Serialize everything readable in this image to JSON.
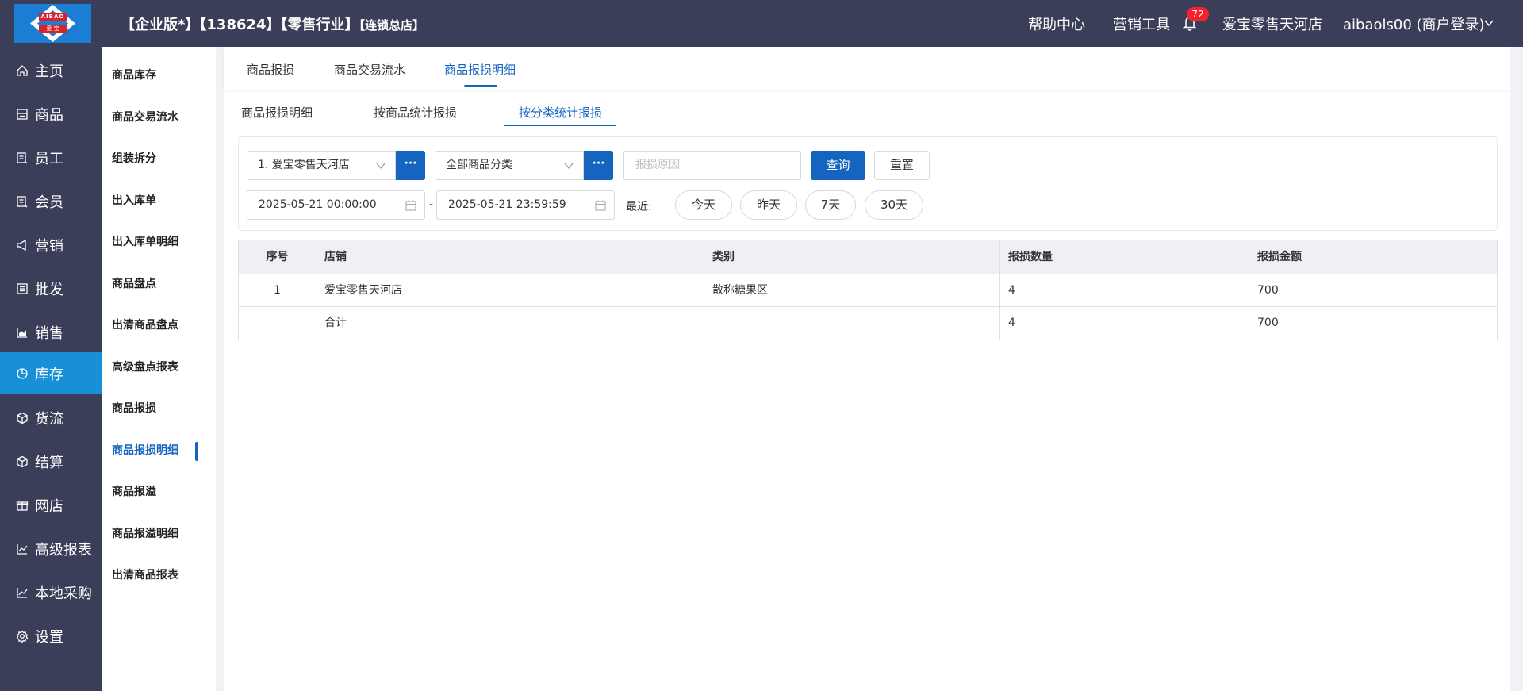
{
  "header": {
    "title_main": "【企业版*】【138624】【零售行业】",
    "title_small": "【连锁总店】",
    "help_center": "帮助中心",
    "marketing_tools": "营销工具",
    "notification_count": "72",
    "store_name": "爱宝零售天河店",
    "user": "aibaols00 (商户登录)",
    "logo_top": "AIBAO",
    "logo_bottom": "爱 宝",
    "colors": {
      "header_bg": "#3b3e58",
      "accent": "#1565c0",
      "active_nav": "#1890d8",
      "badge": "#f5222d"
    }
  },
  "mainnav": {
    "items": [
      {
        "label": "主页",
        "icon": "home-icon"
      },
      {
        "label": "商品",
        "icon": "product-icon"
      },
      {
        "label": "员工",
        "icon": "employee-icon"
      },
      {
        "label": "会员",
        "icon": "member-icon"
      },
      {
        "label": "营销",
        "icon": "megaphone-icon"
      },
      {
        "label": "批发",
        "icon": "wholesale-icon"
      },
      {
        "label": "销售",
        "icon": "sales-chart-icon"
      },
      {
        "label": "库存",
        "icon": "pie-chart-icon"
      },
      {
        "label": "货流",
        "icon": "cube-icon"
      },
      {
        "label": "结算",
        "icon": "settle-icon"
      },
      {
        "label": "网店",
        "icon": "gift-icon"
      },
      {
        "label": "高级报表",
        "icon": "line-chart-icon"
      },
      {
        "label": "本地采购",
        "icon": "line-chart-icon"
      },
      {
        "label": "设置",
        "icon": "gear-icon"
      }
    ],
    "active_index": 7
  },
  "subnav": {
    "items": [
      "商品库存",
      "商品交易流水",
      "组装拆分",
      "出入库单",
      "出入库单明细",
      "商品盘点",
      "出清商品盘点",
      "高级盘点报表",
      "商品报损",
      "商品报损明细",
      "商品报溢",
      "商品报溢明细",
      "出清商品报表"
    ],
    "active_index": 9
  },
  "tabs1": {
    "items": [
      "商品报损",
      "商品交易流水",
      "商品报损明细"
    ],
    "active_index": 2
  },
  "tabs2": {
    "items": [
      "商品报损明细",
      "按商品统计报损",
      "按分类统计报损"
    ],
    "active_index": 2
  },
  "filters": {
    "store_value": "1. 爱宝零售天河店",
    "category_value": "全部商品分类",
    "more_label": "···",
    "reason_placeholder": "报损原因",
    "query_label": "查询",
    "reset_label": "重置",
    "start_time": "2025-05-21 00:00:00",
    "end_time": "2025-05-21 23:59:59",
    "range_sep": "-",
    "recent_label": "最近:",
    "quick_ranges": [
      "今天",
      "昨天",
      "7天",
      "30天"
    ]
  },
  "table": {
    "columns": [
      "序号",
      "店铺",
      "类别",
      "报损数量",
      "报损金额"
    ],
    "rows": [
      [
        "1",
        "爱宝零售天河店",
        "散称糖果区",
        "4",
        "700"
      ],
      [
        "",
        "合计",
        "",
        "4",
        "700"
      ]
    ]
  }
}
